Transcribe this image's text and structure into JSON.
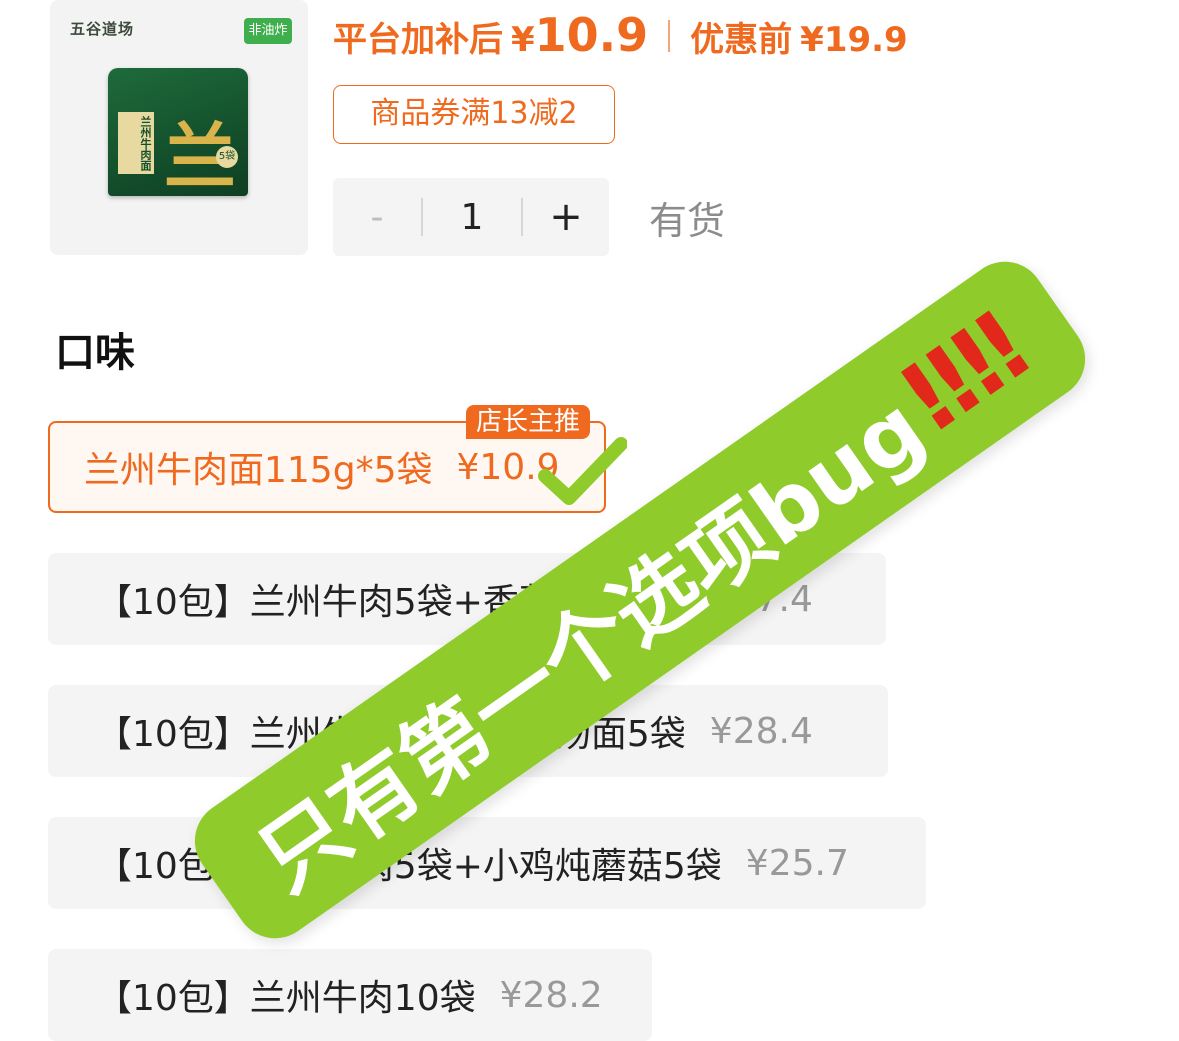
{
  "product": {
    "image_brand": "五谷道场",
    "image_tag": "非油炸",
    "image_pack_label": "兰州牛肉面",
    "image_pack_glyph": "兰",
    "image_pack_badge": "5袋"
  },
  "price": {
    "after_label": "平台加补后",
    "currency": "¥",
    "after_value": "10.9",
    "before_label": "优惠前",
    "before_value": "¥19.9"
  },
  "coupon": "商品券满13减2",
  "quantity": {
    "minus": "-",
    "value": "1",
    "plus": "+"
  },
  "stock": "有货",
  "flavor": {
    "title": "口味",
    "badge": "店长主推",
    "options": [
      {
        "label": "兰州牛肉面115g*5袋",
        "price": "¥10.9",
        "selected": true
      },
      {
        "label": "【10包】兰州牛肉5袋+香菜拌面5袋",
        "price": "¥27.4",
        "selected": false
      },
      {
        "label": "【10包】兰州牛肉5袋+香菜汤面5袋",
        "price": "¥28.4",
        "selected": false
      },
      {
        "label": "【10包】兰州牛肉5袋+小鸡炖蘑菇5袋",
        "price": "¥25.7",
        "selected": false
      },
      {
        "label": "【10包】兰州牛肉10袋",
        "price": "¥28.2",
        "selected": false
      }
    ]
  },
  "annotation": {
    "text": "只有第一个选项bug",
    "marks": "‼‼",
    "color": "#8fcb2a",
    "mark_color": "#e2271b"
  },
  "colors": {
    "accent": "#ef6a1f"
  }
}
